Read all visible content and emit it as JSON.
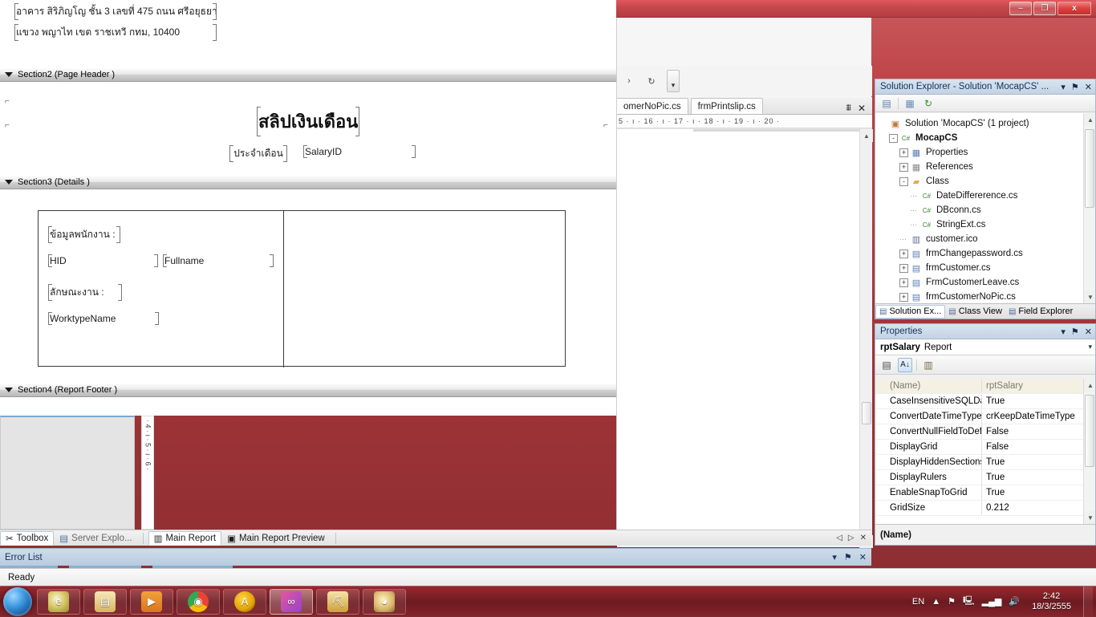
{
  "window": {
    "minimize_label": "–",
    "restore_label": "❐",
    "close_label": "x"
  },
  "report": {
    "address_line1": "อาคาร สิริภิญโญ ชั้น 3 เลขที่ 475 ถนน ศรีอยุธยา",
    "address_line2": "แขวง พญาไท เขต ราชเทวี กทม, 10400",
    "section2_label": "Section2 (Page Header  )",
    "section3_label": "Section3 (Details  )",
    "section4_label": "Section4 (Report Footer  )",
    "title": "สลิปเงินเดือน",
    "month_label": "ประจำเดือน",
    "salary_id_field": "SalaryID",
    "employee_info_label": "ข้อมูลพนักงาน :",
    "hid_field": "HID",
    "fullname_field": "Fullname",
    "worktype_label": "ลักษณะงาน :",
    "worktype_field": "WorktypeName"
  },
  "editor": {
    "tab_partial": "omerNoPic.cs",
    "tab_active": "frmPrintslip.cs",
    "dropdown_icon": "chevron-down-icon",
    "close_icon": "close-icon",
    "ruler_marks": "5 ·  ı  · 16 ·  ı  · 17 ·  ı  · 18 ·  ı  · 19 ·  ı  · 20 ·"
  },
  "dock_tabs": {
    "toolbox": "Toolbox",
    "server_explorer": "Server Explo...",
    "main_report": "Main Report",
    "main_report_preview": "Main Report Preview",
    "nav_prev": "◁",
    "nav_next": "▷",
    "nav_close": "✕"
  },
  "error_list": {
    "title": "Error List",
    "dropdown": "▾",
    "pin": "⚑",
    "close": "✕"
  },
  "status": {
    "text": "Ready"
  },
  "ruler_v": {
    "marks": "·  4  ·  ı  ·  5  ·  ı  ·  6  ·"
  },
  "solution_explorer": {
    "title": "Solution Explorer - Solution 'MocapCS' ...",
    "dropdown": "▾",
    "pin": "⚑",
    "close": "✕",
    "toolbar": [
      {
        "name": "properties-window-icon",
        "glyph": "▤"
      },
      {
        "name": "show-all-files-icon",
        "glyph": "▧"
      },
      {
        "name": "refresh-icon",
        "glyph": "↻"
      }
    ],
    "tree": [
      {
        "label": "Solution 'MocapCS' (1 project)",
        "indent": 0,
        "expander": "none",
        "icon": "solution-icon",
        "glyph": "▣",
        "color": "#c07a3a",
        "bold": false
      },
      {
        "label": "MocapCS",
        "indent": 1,
        "expander": "-",
        "icon": "csharp-project-icon",
        "glyph": "C#",
        "color": "#3a7a3a",
        "bold": true
      },
      {
        "label": "Properties",
        "indent": 2,
        "expander": "+",
        "icon": "properties-folder-icon",
        "glyph": "▦",
        "color": "#5a7fb5",
        "bold": false
      },
      {
        "label": "References",
        "indent": 2,
        "expander": "+",
        "icon": "references-icon",
        "glyph": "▦",
        "color": "#8a8a8a",
        "bold": false
      },
      {
        "label": "Class",
        "indent": 2,
        "expander": "-",
        "icon": "folder-icon",
        "glyph": "▰",
        "color": "#e0ab4a",
        "bold": false
      },
      {
        "label": "DateDiffererence.cs",
        "indent": 3,
        "expander": "dots",
        "icon": "csharp-file-icon",
        "glyph": "C#",
        "color": "#3a7a3a",
        "bold": false
      },
      {
        "label": "DBconn.cs",
        "indent": 3,
        "expander": "dots",
        "icon": "csharp-file-icon",
        "glyph": "C#",
        "color": "#3a7a3a",
        "bold": false
      },
      {
        "label": "StringExt.cs",
        "indent": 3,
        "expander": "dots",
        "icon": "csharp-file-icon",
        "glyph": "C#",
        "color": "#3a7a3a",
        "bold": false
      },
      {
        "label": "customer.ico",
        "indent": 2,
        "expander": "dots",
        "icon": "icon-file-icon",
        "glyph": "▥",
        "color": "#6a6a9a",
        "bold": false
      },
      {
        "label": "frmChangepassword.cs",
        "indent": 2,
        "expander": "+",
        "icon": "form-icon",
        "glyph": "▤",
        "color": "#5a7fb5",
        "bold": false
      },
      {
        "label": "frmCustomer.cs",
        "indent": 2,
        "expander": "+",
        "icon": "form-icon",
        "glyph": "▤",
        "color": "#5a7fb5",
        "bold": false
      },
      {
        "label": "FrmCustomerLeave.cs",
        "indent": 2,
        "expander": "+",
        "icon": "form-icon",
        "glyph": "▤",
        "color": "#5a7fb5",
        "bold": false
      },
      {
        "label": "frmCustomerNoPic.cs",
        "indent": 2,
        "expander": "+",
        "icon": "form-icon",
        "glyph": "▤",
        "color": "#5a7fb5",
        "bold": false
      }
    ],
    "bottom_tabs": [
      {
        "label": "Solution Ex...",
        "icon": "solution-explorer-icon",
        "active": true
      },
      {
        "label": "Class View",
        "icon": "class-view-icon",
        "active": false
      },
      {
        "label": "Field Explorer",
        "icon": "field-explorer-icon",
        "active": false
      }
    ]
  },
  "properties": {
    "title": "Properties",
    "dropdown": "▾",
    "pin": "⚑",
    "close": "✕",
    "object_name": "rptSalary",
    "object_type": "Report",
    "object_caret": "▾",
    "toolbar": [
      {
        "name": "categorized-icon",
        "glyph": "▤",
        "framed": false
      },
      {
        "name": "alphabetical-sort-icon",
        "glyph": "A↓",
        "framed": true
      },
      {
        "name": "property-pages-icon",
        "glyph": "▥",
        "framed": false
      }
    ],
    "rows": [
      {
        "key": "(Name)",
        "value": "rptSalary"
      },
      {
        "key": "CaseInsensitiveSQLData",
        "value": "True"
      },
      {
        "key": "ConvertDateTimeType",
        "value": "crKeepDateTimeType"
      },
      {
        "key": "ConvertNullFieldToDef;",
        "value": "False"
      },
      {
        "key": "DisplayGrid",
        "value": "False"
      },
      {
        "key": "DisplayHiddenSections",
        "value": "True"
      },
      {
        "key": "DisplayRulers",
        "value": "True"
      },
      {
        "key": "EnableSnapToGrid",
        "value": "True"
      },
      {
        "key": "GridSize",
        "value": "0.212"
      }
    ],
    "description": "(Name)"
  },
  "taskbar": {
    "start_icon": "windows-start-orb",
    "items": [
      {
        "name": "internet-explorer-icon",
        "glyph": "e",
        "active": false
      },
      {
        "name": "windows-explorer-icon",
        "glyph": "▤",
        "active": false
      },
      {
        "name": "media-player-icon",
        "glyph": "▶",
        "active": false
      },
      {
        "name": "google-chrome-icon",
        "glyph": "◉",
        "active": false
      },
      {
        "name": "autocad-icon",
        "glyph": "A",
        "active": false
      },
      {
        "name": "visual-studio-icon",
        "glyph": "∞",
        "active": true
      },
      {
        "name": "sql-server-tools-icon",
        "glyph": "⛏",
        "active": false
      },
      {
        "name": "paint-icon",
        "glyph": "◕",
        "active": false
      }
    ],
    "tray": {
      "language": "EN",
      "show_hidden": "▲",
      "action_center_icon": "flag-icon",
      "network_status_icon": "network-icon",
      "signal_icon": "signal-bars-icon",
      "volume_icon": "speaker-icon"
    },
    "clock": {
      "time": "2:42",
      "date": "18/3/2555"
    }
  }
}
